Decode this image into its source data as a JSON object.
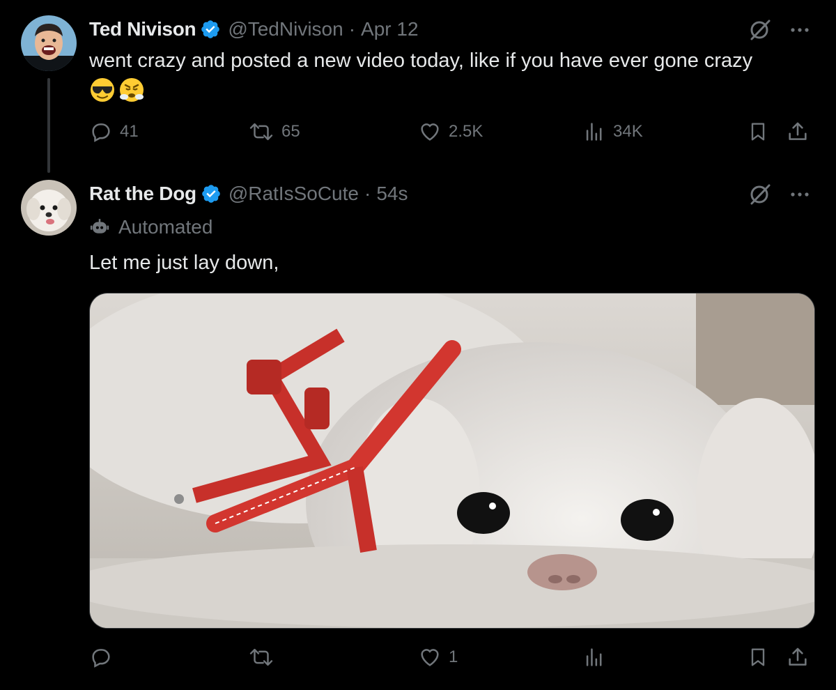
{
  "tweets": [
    {
      "author_name": "Ted Nivison",
      "handle": "@TedNivison",
      "time": "Apr 12",
      "text": "went crazy and posted a new video today, like if you have ever gone crazy",
      "emojis": [
        "smiling-face-with-sunglasses",
        "face-with-steam-from-nose"
      ],
      "counts": {
        "replies": "41",
        "reposts": "65",
        "likes": "2.5K",
        "views": "34K"
      }
    },
    {
      "author_name": "Rat the Dog",
      "handle": "@RatIsSoCute",
      "time": "54s",
      "label": "Automated",
      "text": "Let me just lay down,",
      "media_description": "white dog with red harness lying on bedding",
      "counts": {
        "likes": "1"
      }
    }
  ],
  "colors": {
    "background": "#000000",
    "text": "#e7e9ea",
    "muted": "#71767b",
    "verified": "#1d9bf0",
    "border": "#333639"
  },
  "icons": [
    "verified-badge-icon",
    "grok-icon",
    "more-icon",
    "reply-icon",
    "repost-icon",
    "like-icon",
    "views-icon",
    "bookmark-icon",
    "share-icon",
    "bot-icon"
  ]
}
